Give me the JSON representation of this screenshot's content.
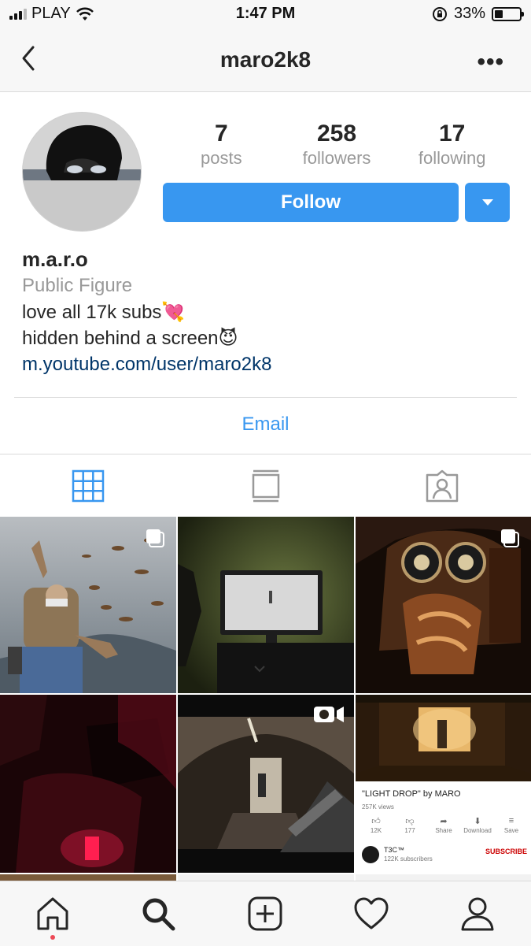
{
  "status_bar": {
    "carrier": "PLAY",
    "time": "1:47 PM",
    "battery_percent": "33%",
    "battery_level": 0.33,
    "icons": [
      "signal-icon",
      "wifi-icon",
      "orientation-lock-icon",
      "battery-icon"
    ]
  },
  "nav": {
    "title": "maro2k8",
    "back_icon": "chevron-left-icon",
    "more_label": "•••"
  },
  "profile": {
    "stats": [
      {
        "value": "7",
        "label": "posts"
      },
      {
        "value": "258",
        "label": "followers"
      },
      {
        "value": "17",
        "label": "following"
      }
    ],
    "follow_label": "Follow",
    "dropdown_icon": "caret-down-icon",
    "name": "m.a.r.o",
    "category": "Public Figure",
    "bio_lines": [
      "love all 17k subs💘",
      "hidden behind a screen😈"
    ],
    "link": "m.youtube.com/user/maro2k8",
    "email_label": "Email"
  },
  "tabs": [
    {
      "name": "grid-icon",
      "active": true
    },
    {
      "name": "feed-icon",
      "active": false
    },
    {
      "name": "tagged-icon",
      "active": false
    }
  ],
  "posts": [
    {
      "badge": "multiple-posts-icon"
    },
    {
      "badge": ""
    },
    {
      "badge": "multiple-posts-icon"
    },
    {
      "badge": ""
    },
    {
      "badge": "video-icon"
    },
    {
      "badge": ""
    }
  ],
  "youtube_card": {
    "title": "\"LIGHT DROP\" by MARO",
    "views": "257K views",
    "actions": [
      {
        "icon": "thumbs-up-icon",
        "label": "12K"
      },
      {
        "icon": "thumbs-down-icon",
        "label": "177"
      },
      {
        "icon": "share-icon",
        "label": "Share"
      },
      {
        "icon": "download-icon",
        "label": "Download"
      },
      {
        "icon": "save-icon",
        "label": "Save"
      }
    ],
    "channel": "T3C™",
    "subscribers": "122K subscribers",
    "subscribe_label": "SUBSCRIBE"
  },
  "bottom_bar": [
    "home-icon",
    "search-icon",
    "new-post-icon",
    "activity-icon",
    "profile-icon"
  ],
  "colors": {
    "accent": "#3897f0",
    "link": "#003569",
    "muted": "#999999",
    "notification": "#ed4956"
  }
}
